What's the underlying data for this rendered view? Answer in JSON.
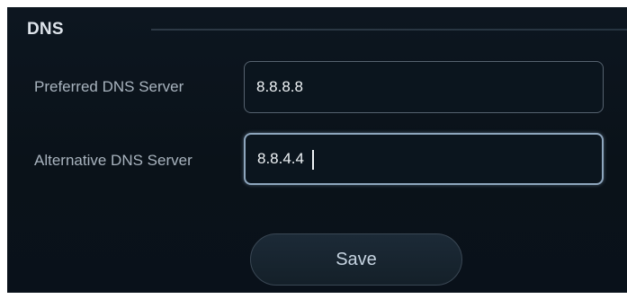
{
  "section": {
    "title": "DNS"
  },
  "fields": {
    "preferred": {
      "label": "Preferred DNS Server",
      "value": "8.8.8.8"
    },
    "alternative": {
      "label": "Alternative DNS Server",
      "value": "8.8.4.4"
    }
  },
  "actions": {
    "save_label": "Save"
  },
  "colors": {
    "background": "#0b141c",
    "field_border": "#56626f",
    "focused_border": "#8ea6bd",
    "text": "#eef2f5",
    "label_text": "#a8b3be"
  }
}
